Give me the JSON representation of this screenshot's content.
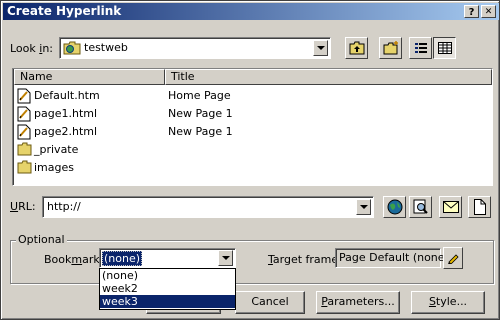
{
  "window": {
    "title": "Create Hyperlink",
    "help_label": "?",
    "close_label": "✕"
  },
  "look_in": {
    "label_prefix": "Look ",
    "label_accel": "i",
    "label_suffix": "n:",
    "folder": "testweb"
  },
  "file_list": {
    "columns": [
      "Name",
      "Title"
    ],
    "rows": [
      {
        "name": "Default.htm",
        "title": "Home Page",
        "icon": "html-file-icon"
      },
      {
        "name": "page1.html",
        "title": "New Page 1",
        "icon": "html-file-icon"
      },
      {
        "name": "page2.html",
        "title": "New Page 1",
        "icon": "html-file-icon"
      },
      {
        "name": "_private",
        "title": "",
        "icon": "folder-icon"
      },
      {
        "name": "images",
        "title": "",
        "icon": "folder-icon"
      }
    ]
  },
  "url": {
    "label_accel": "U",
    "label_rest": "RL:",
    "value": "http://"
  },
  "optional": {
    "group_label": "Optional",
    "bookmark_label_prefix": "Book",
    "bookmark_label_accel": "m",
    "bookmark_label_suffix": "ark:",
    "bookmark_value": "(none)",
    "bookmark_options": [
      "(none)",
      "week2",
      "week3"
    ],
    "bookmark_highlighted": "week3",
    "target_label_accel": "T",
    "target_label_rest": "arget frame:",
    "target_value": "Page Default (none)"
  },
  "buttons": {
    "cancel": "Cancel",
    "parameters_accel": "P",
    "parameters_rest": "arameters...",
    "style_accel": "S",
    "style_rest": "tyle..."
  },
  "colors": {
    "face": "#d4d0c8",
    "titlebar_start": "#0a246a",
    "titlebar_end": "#a6caf0",
    "selection": "#0a246a"
  }
}
